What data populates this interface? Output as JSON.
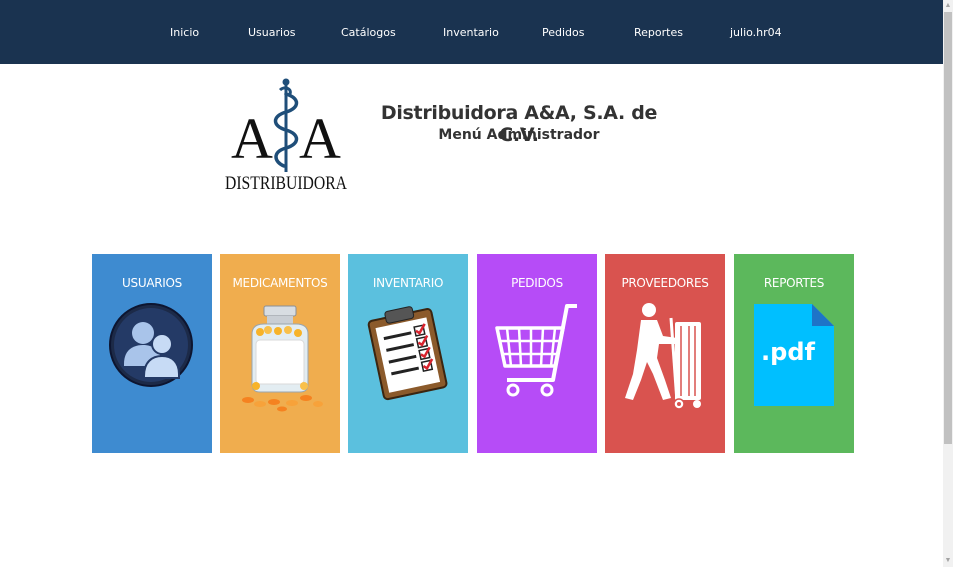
{
  "navbar": {
    "items": [
      {
        "label": "Inicio"
      },
      {
        "label": "Usuarios"
      },
      {
        "label": "Catálogos"
      },
      {
        "label": "Inventario"
      },
      {
        "label": "Pedidos"
      },
      {
        "label": "Reportes"
      },
      {
        "label": "julio.hr04"
      }
    ]
  },
  "header": {
    "logo_text": "A&A DISTRIBUIDORA",
    "company": "Distribuidora A&A, S.A. de C.V.",
    "subtitle": "Menú Administrador"
  },
  "tiles": [
    {
      "label": "USUARIOS",
      "color": "#3e8bd0",
      "icon": "users-icon"
    },
    {
      "label": "MEDICAMENTOS",
      "color": "#f0ad4e",
      "icon": "pill-bottle-icon"
    },
    {
      "label": "INVENTARIO",
      "color": "#5bc0de",
      "icon": "clipboard-checklist-icon"
    },
    {
      "label": "PEDIDOS",
      "color": "#b64cf7",
      "icon": "shopping-cart-icon"
    },
    {
      "label": "PROVEEDORES",
      "color": "#d9534f",
      "icon": "delivery-person-icon"
    },
    {
      "label": "REPORTES",
      "color": "#5cb85c",
      "icon": "pdf-file-icon",
      "icon_text": ".pdf"
    }
  ]
}
